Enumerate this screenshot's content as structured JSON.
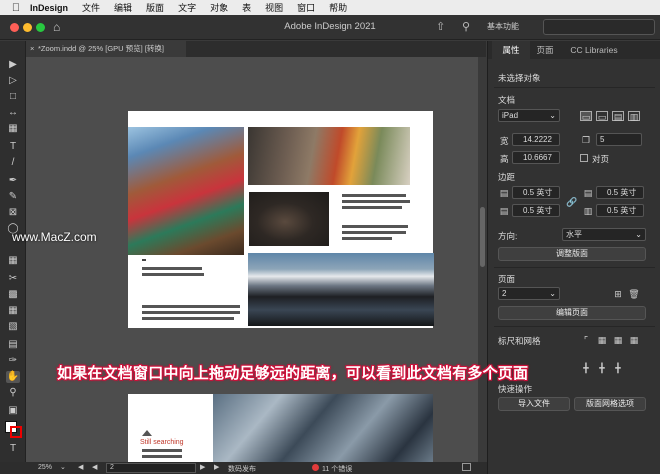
{
  "menubar": {
    "app": "InDesign",
    "items": [
      "文件",
      "编辑",
      "版面",
      "文字",
      "对象",
      "表",
      "视图",
      "窗口",
      "帮助"
    ]
  },
  "titlebar": {
    "title": "Adobe InDesign 2021",
    "workspace": "基本功能"
  },
  "document_tab": {
    "close": "×",
    "label": "*Zoom.indd @ 25% [GPU 预览] [转换]"
  },
  "canvas": {
    "still_searching": "Still searching"
  },
  "statusbar": {
    "zoom": "25%",
    "page": "2",
    "profile": "数码发布",
    "errors": "11 个错误"
  },
  "panel": {
    "tabs": [
      "属性",
      "页面",
      "CC Libraries"
    ],
    "no_selection": "未选择对象",
    "document_section": "文档",
    "preset": "iPad",
    "width_label": "宽",
    "width_value": "14.2222",
    "height_label": "高",
    "height_value": "10.6667",
    "pages_value": "5",
    "facing_pages": "对页",
    "margins_section": "边距",
    "margin_top": "0.5 英寸",
    "margin_bottom": "0.5 英寸",
    "margin_left": "0.5 英寸",
    "margin_right": "0.5 英寸",
    "orientation_label": "方向:",
    "orientation_value": "水平",
    "adjust_layout": "调整版面",
    "page_section": "页面",
    "page_value": "2",
    "edit_page": "编辑页面",
    "rulers_grids": "标尺和网格",
    "quick_actions": "快速操作",
    "import_file": "导入文件",
    "layout_grid_options": "版面网格选项"
  },
  "overlay": {
    "caption": "如果在文档窗口中向上拖动足够远的距离，可以看到此文档有多个页面",
    "watermark": "www.MacZ.com"
  }
}
